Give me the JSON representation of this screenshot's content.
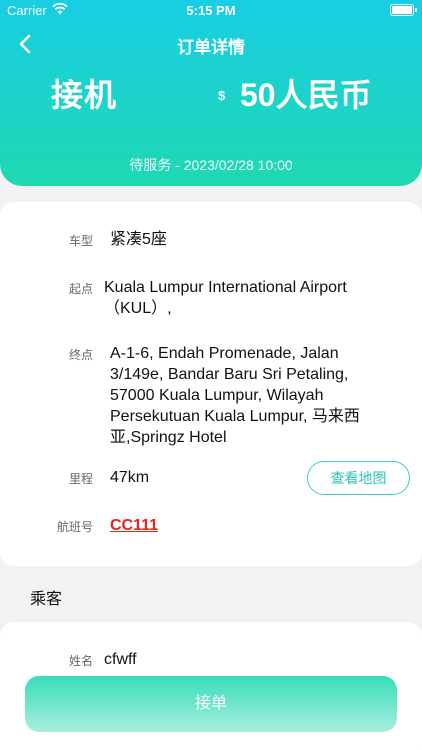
{
  "status_bar": {
    "carrier": "Carrier",
    "time": "5:15 PM"
  },
  "nav": {
    "title": "订单详情"
  },
  "summary": {
    "service": "接机",
    "currency_symbol": "$",
    "price": "50人民币",
    "status": "待服务 - 2023/02/28 10:00"
  },
  "details": {
    "car_type_label": "车型",
    "car_type": "紧凑5座",
    "origin_label": "起点",
    "origin": "Kuala Lumpur International Airport（KUL）,",
    "destination_label": "终点",
    "destination": "A-1-6, Endah Promenade, Jalan 3/149e, Bandar Baru Sri Petaling, 57000 Kuala Lumpur, Wilayah Persekutuan Kuala Lumpur, 马来西亚,Springz Hotel",
    "distance_label": "里程",
    "distance": "47km",
    "map_button": "查看地图",
    "flight_label": "航班号",
    "flight": "CC111"
  },
  "passenger": {
    "section_title": "乘客",
    "name_label": "姓名",
    "name": "cfwff"
  },
  "action": {
    "accept_button": "接单"
  }
}
